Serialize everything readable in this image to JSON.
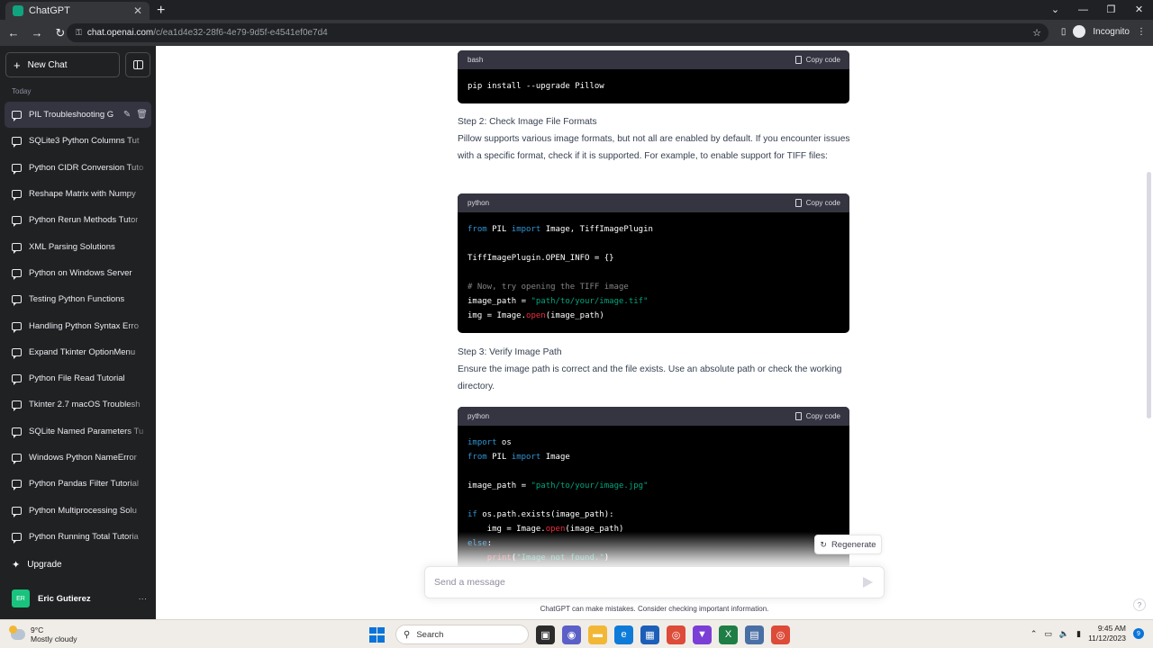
{
  "browser": {
    "tab_title": "ChatGPT",
    "tab_close": "✕",
    "new_tab": "+",
    "url_host": "chat.openai.com",
    "url_path": "/c/ea1d4e32-28f6-4e79-9d5f-e4541ef0e7d4",
    "profile_label": "Incognito"
  },
  "sidebar": {
    "new_chat_label": "New Chat",
    "section_label": "Today",
    "conversations": [
      "PIL Troubleshooting G",
      "SQLite3 Python Columns Tut",
      "Python CIDR Conversion Tuto",
      "Reshape Matrix with Numpy",
      "Python Rerun Methods Tutor",
      "XML Parsing Solutions",
      "Python on Windows Server",
      "Testing Python Functions",
      "Handling Python Syntax Erro",
      "Expand Tkinter OptionMenu",
      "Python File Read Tutorial",
      "Tkinter 2.7 macOS Troublesh",
      "SQLite Named Parameters Tu",
      "Windows Python NameError",
      "Python Pandas Filter Tutorial",
      "Python Multiprocessing Solu",
      "Python Running Total Tutoria"
    ],
    "upgrade_label": "Upgrade",
    "user_initials": "ER",
    "user_name": "Eric Gutierez"
  },
  "chat": {
    "copy_label": "Copy code",
    "block1_lang": "bash",
    "step2_heading": "Step 2: Check Image File Formats",
    "step2_body": "Pillow supports various image formats, but not all are enabled by default. If you encounter issues with a specific format, check if it is supported. For example, to enable support for TIFF files:",
    "block2_lang": "python",
    "step3_heading": "Step 3: Verify Image Path",
    "step3_body": "Ensure the image path is correct and the file exists. Use an absolute path or check the working directory.",
    "block3_lang": "python",
    "regenerate_label": "Regenerate",
    "input_placeholder": "Send a message",
    "disclaimer": "ChatGPT can make mistakes. Consider checking important information.",
    "help_label": "?"
  },
  "taskbar": {
    "temperature": "9°C",
    "weather": "Mostly cloudy",
    "search_label": "Search",
    "time": "9:45 AM",
    "date": "11/12/2023",
    "notification_count": "9"
  }
}
